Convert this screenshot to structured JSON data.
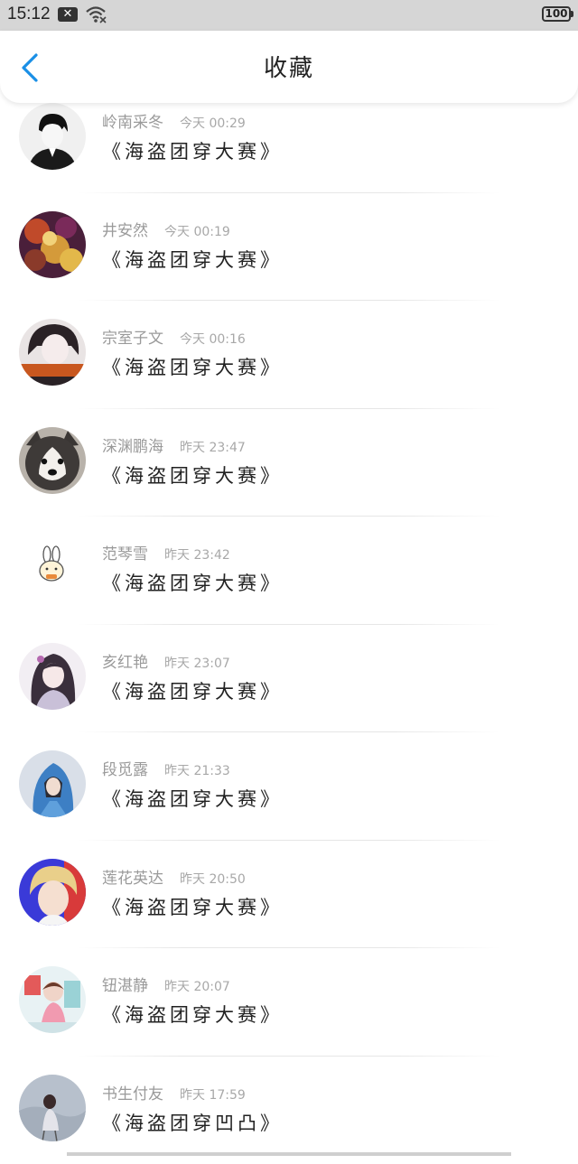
{
  "status": {
    "time": "15:12",
    "notification": "✕",
    "battery": "100"
  },
  "header": {
    "title": "收藏"
  },
  "items": [
    {
      "name": "岭南采冬",
      "time": "今天 00:29",
      "work": "《海盗团穿大赛》",
      "avatar": "avatar-boy-dark"
    },
    {
      "name": "井安然",
      "time": "今天 00:19",
      "work": "《海盗团穿大赛》",
      "avatar": "avatar-flowers"
    },
    {
      "name": "宗室子文",
      "time": "今天 00:16",
      "work": "《海盗团穿大赛》",
      "avatar": "avatar-girl-text"
    },
    {
      "name": "深渊鹏海",
      "time": "昨天 23:47",
      "work": "《海盗团穿大赛》",
      "avatar": "avatar-husky"
    },
    {
      "name": "范琴雪",
      "time": "昨天 23:42",
      "work": "《海盗团穿大赛》",
      "avatar": "avatar-bunny"
    },
    {
      "name": "亥红艳",
      "time": "昨天 23:07",
      "work": "《海盗团穿大赛》",
      "avatar": "avatar-anime-girl"
    },
    {
      "name": "段觅露",
      "time": "昨天 21:33",
      "work": "《海盗团穿大赛》",
      "avatar": "avatar-hoodie-blue"
    },
    {
      "name": "莲花英达",
      "time": "昨天 20:50",
      "work": "《海盗团穿大赛》",
      "avatar": "avatar-blond-boy"
    },
    {
      "name": "钮湛静",
      "time": "昨天 20:07",
      "work": "《海盗团穿大赛》",
      "avatar": "avatar-pink-girl"
    },
    {
      "name": "书生付友",
      "time": "昨天 17:59",
      "work": "《海盗团穿凹凸》",
      "avatar": "avatar-sketch"
    }
  ],
  "colors": {
    "accent": "#1a8fe6",
    "statusbar": "#d6d6d6",
    "name_text": "#9a9a9a",
    "work_text": "#222222"
  }
}
